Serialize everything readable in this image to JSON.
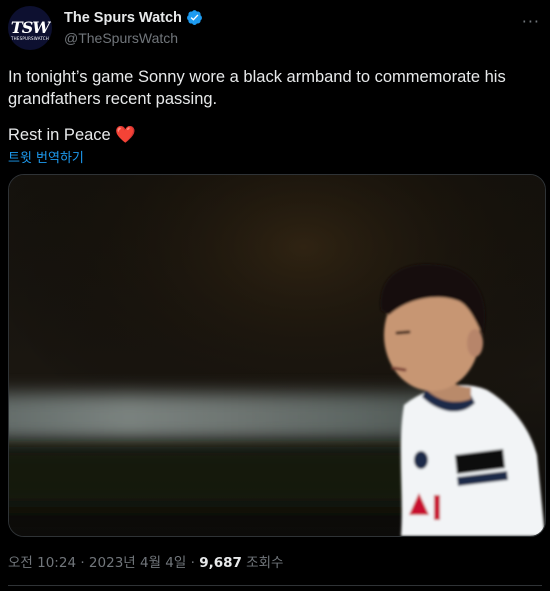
{
  "account": {
    "display_name": "The Spurs Watch",
    "handle": "@TheSpursWatch",
    "avatar_text": "TSW",
    "avatar_subtext": "THESPURSWATCH",
    "verified": true
  },
  "more_label": "···",
  "tweet": {
    "line1": "In tonight’s game Sonny wore a black armband to commemorate his grandfathers recent passing.",
    "line2": "Rest in Peace",
    "heart": "❤️",
    "translate_label": "트윗 번역하기"
  },
  "meta": {
    "time": "오전 10:24",
    "sep1": " · ",
    "date": "2023년 4월 4일",
    "sep2": " · ",
    "views": "9,687",
    "views_label": " 조회수"
  },
  "colors": {
    "background": "#000000",
    "text": "#e7e9ea",
    "secondary": "#71767b",
    "accent": "#1d9bf0",
    "heart": "#f4212e"
  }
}
